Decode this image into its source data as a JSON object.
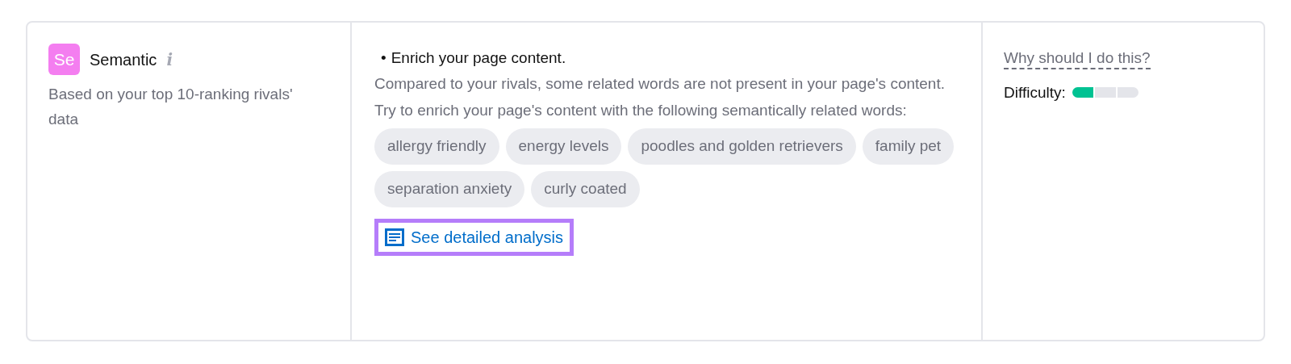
{
  "category": {
    "badge": "Se",
    "title": "Semantic",
    "info": "i",
    "description": "Based on your top 10-ranking rivals' data"
  },
  "recommendation": {
    "bullet": "•",
    "title": "Enrich your page content.",
    "paragraphs": [
      "Compared to your rivals, some related words are not present in your page's content.",
      "Try to enrich your page's content with the following semantically related words:"
    ],
    "tags": [
      "allergy friendly",
      "energy levels",
      "poodles and golden retrievers",
      "family pet",
      "separation anxiety",
      "curly coated"
    ],
    "link": "See detailed analysis"
  },
  "side": {
    "why_link": "Why should I do this?",
    "difficulty_label": "Difficulty:",
    "difficulty": {
      "level": 0.33
    }
  }
}
